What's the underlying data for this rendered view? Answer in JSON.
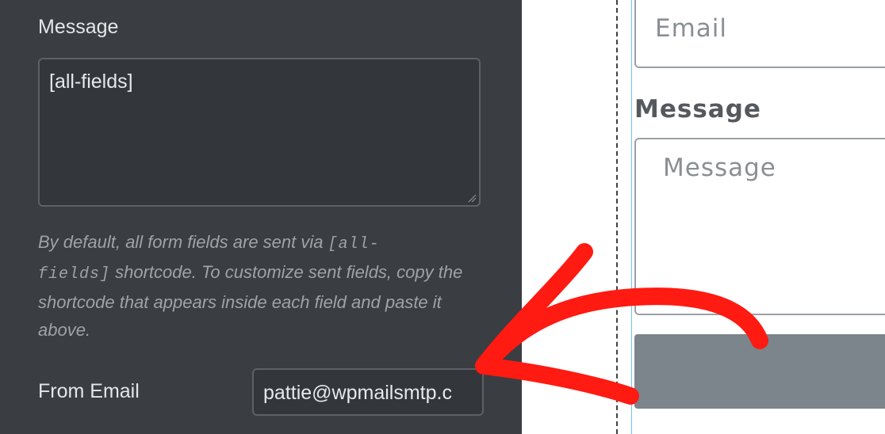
{
  "settings": {
    "message_label": "Message",
    "message_value": "[all-fields]",
    "help_prefix": "By default, all form fields are sent via ",
    "help_code_1": "[all-",
    "help_code_2": "fields]",
    "help_suffix": " shortcode. To customize sent fields, copy the shortcode that appears inside each field and paste it above.",
    "from_email_label": "From Email",
    "from_email_value": "pattie@wpmailsmtp.c"
  },
  "collapse_icon": "chevron-left-icon",
  "preview": {
    "email_placeholder": "Email",
    "message_label": "Message",
    "message_placeholder": "Message"
  },
  "colors": {
    "panel_bg": "#3a3d42",
    "arrow": "#ff1a12",
    "submit_bg": "#7c848c"
  }
}
